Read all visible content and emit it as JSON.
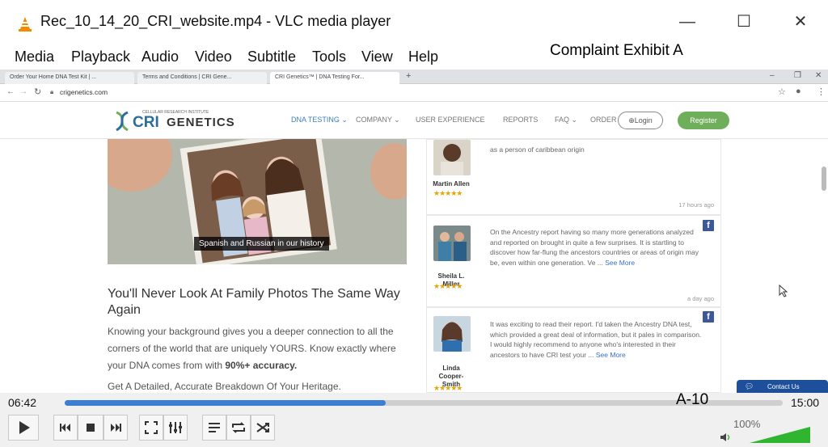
{
  "window": {
    "title": "Rec_10_14_20_CRI_website.mp4 - VLC media player",
    "minimize": "—",
    "maximize": "☐",
    "close": "✕"
  },
  "menu": [
    "Media",
    "Playback",
    "Audio",
    "Video",
    "Subtitle",
    "Tools",
    "View",
    "Help"
  ],
  "overlay_label_top": "Complaint Exhibit A",
  "overlay_label_bottom": "A-10",
  "browser": {
    "tabs": [
      "Order Your Home DNA Test Kit | ...",
      "Terms and Conditions | CRI Gene...",
      "CRI Genetics™ | DNA Testing For..."
    ],
    "new_tab": "+",
    "url": "crigenetics.com",
    "window_minimize": "–",
    "window_restore": "❐",
    "window_close": "✕"
  },
  "site": {
    "logo_small": "CELLULAR RESEARCH INSTITUTE",
    "logo_cri": "CRI",
    "logo_genetics": "GENETICS",
    "nav": [
      "DNA TESTING ⌄",
      "COMPANY ⌄",
      "USER EXPERIENCE",
      "REPORTS",
      "FAQ ⌄",
      "ORDER"
    ],
    "login": "⊕Login",
    "register": "Register",
    "photo_caption": "Spanish and Russian in our history",
    "headline": "You'll Never Look At Family Photos The Same Way Again",
    "paragraph_start": "Knowing your background gives you a deeper connection to all the corners of the world that are uniquely YOURS. Know exactly where your DNA comes from with ",
    "paragraph_bold": "90%+ accuracy.",
    "subhead": "Get A Detailed, Accurate Breakdown Of Your Heritage.",
    "contact_us": "Contact Us",
    "reviews": [
      {
        "name": "Martin Allen",
        "stars": "★★★★★",
        "text": "as a person of caribbean origin",
        "more": "",
        "time": "17 hours ago",
        "fb": ""
      },
      {
        "name": "Sheila L. Miller",
        "stars": "★★★★★",
        "text": "On the Ancestry report having so many more generations analyzed and reported on brought in quite a few surprises. It is startling to discover how far-flung the ancestors countries or areas of origin may be, even within one generation. Ve ... ",
        "more": "See More",
        "time": "a day ago",
        "fb": "f"
      },
      {
        "name": "Linda Cooper-Smith",
        "stars": "★★★★★",
        "text": "It was exciting to read their report. I'd taken the Ancestry DNA test, which provided a great deal of information, but it pales in comparison. I would highly recommend to anyone who's interested in their ancestors to have CRI test your ... ",
        "more": "See More",
        "time": "",
        "fb": "f"
      }
    ]
  },
  "player": {
    "current_time": "06:42",
    "total_time": "15:00",
    "progress": 0.447,
    "volume_label": "100%",
    "volume": 1.0,
    "buttons": [
      "play",
      "previous",
      "stop",
      "next",
      "fullscreen",
      "extended-settings",
      "playlist",
      "loop",
      "random"
    ]
  },
  "colors": {
    "seek_fill": "#3c7fd2",
    "register_green": "#6fae5b",
    "vlc_orange": "#f28b00",
    "contact_blue": "#1d4f9a",
    "star": "#e8a400"
  }
}
